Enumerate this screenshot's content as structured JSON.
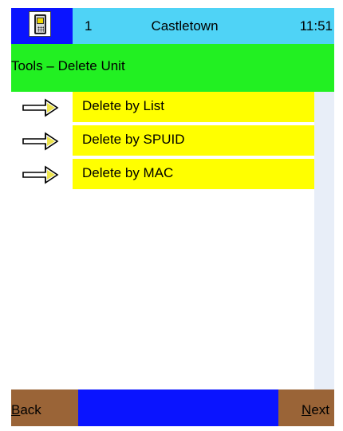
{
  "status_bar": {
    "device_icon": "handset-device-icon",
    "line_number": "1",
    "location": "Castletown",
    "time": "11:51"
  },
  "title": "Tools – Delete Unit",
  "menu": {
    "arrow_icon": "right-arrow-icon",
    "items": [
      {
        "label": "Delete by List"
      },
      {
        "label": "Delete by SPUID"
      },
      {
        "label": "Delete by MAC"
      }
    ]
  },
  "softkeys": {
    "back": {
      "hotkey": "B",
      "rest": "ack"
    },
    "next": {
      "hotkey": "N",
      "rest": "ext"
    }
  },
  "colors": {
    "status_bar": "#4fd3f6",
    "device_box": "#0a14ff",
    "title_bar": "#22f022",
    "menu_item": "#ffff00",
    "softkey": "#9a6437",
    "bottom_bar": "#0a14ff",
    "scroll_track": "#e8eef8"
  }
}
